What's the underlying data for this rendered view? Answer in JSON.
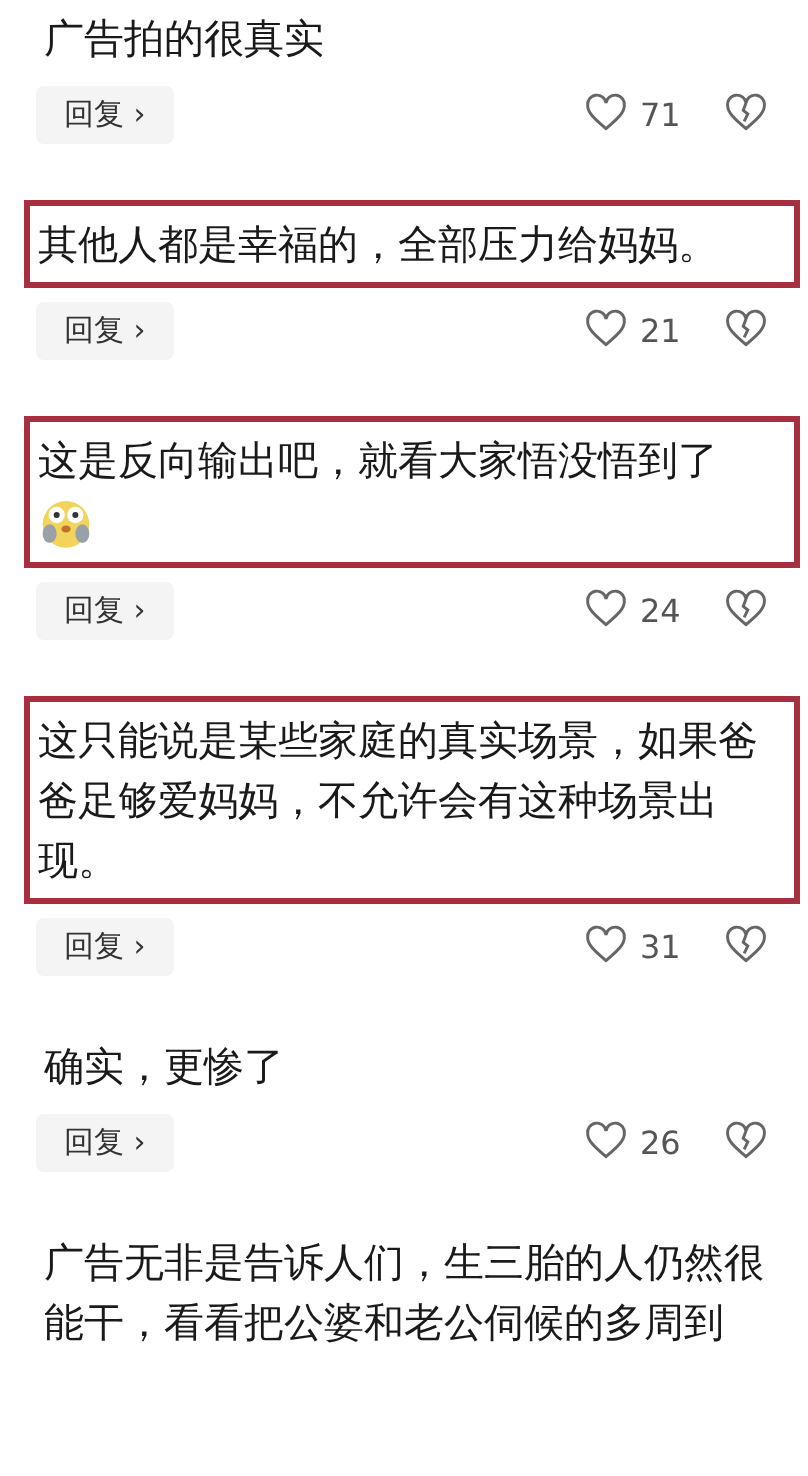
{
  "comments": [
    {
      "text": "广告拍的很真实",
      "highlighted": false,
      "reply": "回复 ›",
      "likes": "71"
    },
    {
      "text": "其他人都是幸福的，全部压力给妈妈。",
      "highlighted": true,
      "reply": "回复 ›",
      "likes": "21"
    },
    {
      "text": "这是反向输出吧，就看大家悟没悟到了",
      "emoji": true,
      "highlighted": true,
      "reply": "回复 ›",
      "likes": "24"
    },
    {
      "text": "这只能说是某些家庭的真实场景，如果爸爸足够爱妈妈，不允许会有这种场景出现。",
      "highlighted": true,
      "reply": "回复 ›",
      "likes": "31"
    },
    {
      "text": "确实，更惨了",
      "highlighted": false,
      "reply": "回复 ›",
      "likes": "26"
    },
    {
      "text": "广告无非是告诉人们，生三胎的人仍然很能干，看看把公婆和老公伺候的多周到",
      "highlighted": false
    }
  ]
}
